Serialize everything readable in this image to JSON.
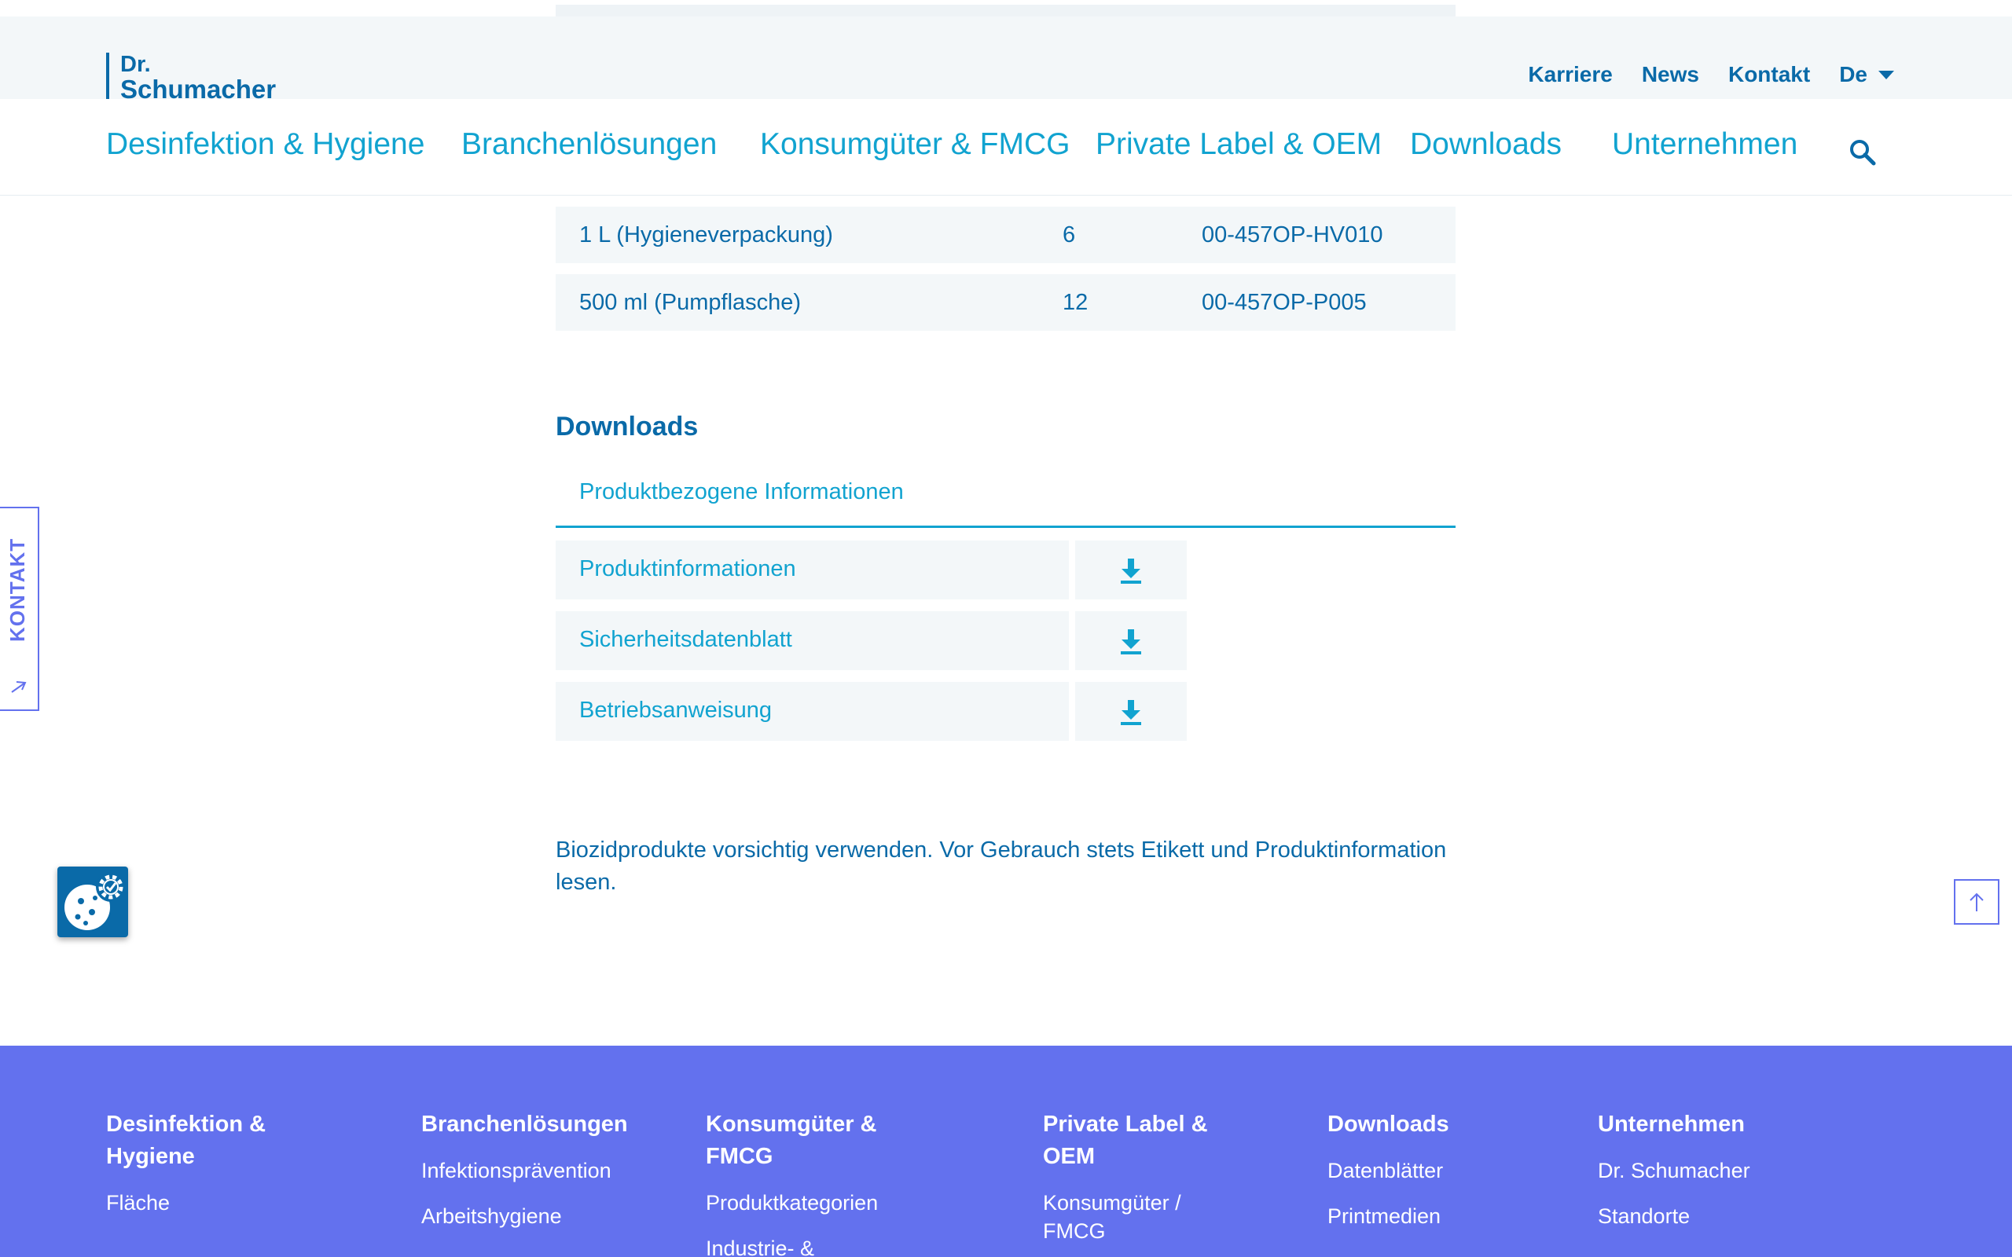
{
  "brand": {
    "line1": "Dr.",
    "line2": "Schumacher"
  },
  "utility_nav": {
    "karriere": "Karriere",
    "news": "News",
    "kontakt": "Kontakt",
    "language": "De"
  },
  "main_nav": {
    "items": [
      "Desinfektion & Hygiene",
      "Branchenlösungen",
      "Konsumgüter & FMCG",
      "Private Label & OEM",
      "Downloads",
      "Unternehmen"
    ]
  },
  "variants": {
    "rows": [
      {
        "size": "1 L (Hygieneverpackung)",
        "qty": "6",
        "article": "00-457OP-HV010"
      },
      {
        "size": "500 ml (Pumpflasche)",
        "qty": "12",
        "article": "00-457OP-P005"
      }
    ]
  },
  "downloads": {
    "title": "Downloads",
    "tab": "Produktbezogene Informationen",
    "items": [
      "Produktinformationen",
      "Sicherheitsdatenblatt",
      "Betriebsanweisung"
    ]
  },
  "notice": "Biozidprodukte vorsichtig verwenden. Vor Gebrauch stets Etikett und Produktinformation lesen.",
  "side_tab": {
    "label": "KONTAKT"
  },
  "footer": {
    "columns": [
      {
        "heading": "Desinfektion & Hygiene",
        "links": [
          "Fläche"
        ]
      },
      {
        "heading": "Branchenlösungen",
        "links": [
          "Infektionsprävention",
          "Arbeitshygiene"
        ]
      },
      {
        "heading": "Konsumgüter & FMCG",
        "links": [
          "Produktkategorien",
          "Industrie- &"
        ]
      },
      {
        "heading": "Private Label & OEM",
        "links": [
          "Konsumgüter / FMCG"
        ]
      },
      {
        "heading": "Downloads",
        "links": [
          "Datenblätter",
          "Printmedien"
        ]
      },
      {
        "heading": "Unternehmen",
        "links": [
          "Dr. Schumacher",
          "Standorte"
        ]
      }
    ]
  },
  "colors": {
    "primary": "#0a6aa8",
    "accent": "#11a3d0",
    "footer": "#6371ee",
    "panel": "#f3f7f9"
  },
  "icons": {
    "search": "search-icon",
    "download": "download-icon",
    "cookie": "cookie-settings-icon",
    "to_top": "arrow-up-icon",
    "kontakt_arrow": "arrow-up-right-icon",
    "language_caret": "caret-down-icon"
  }
}
